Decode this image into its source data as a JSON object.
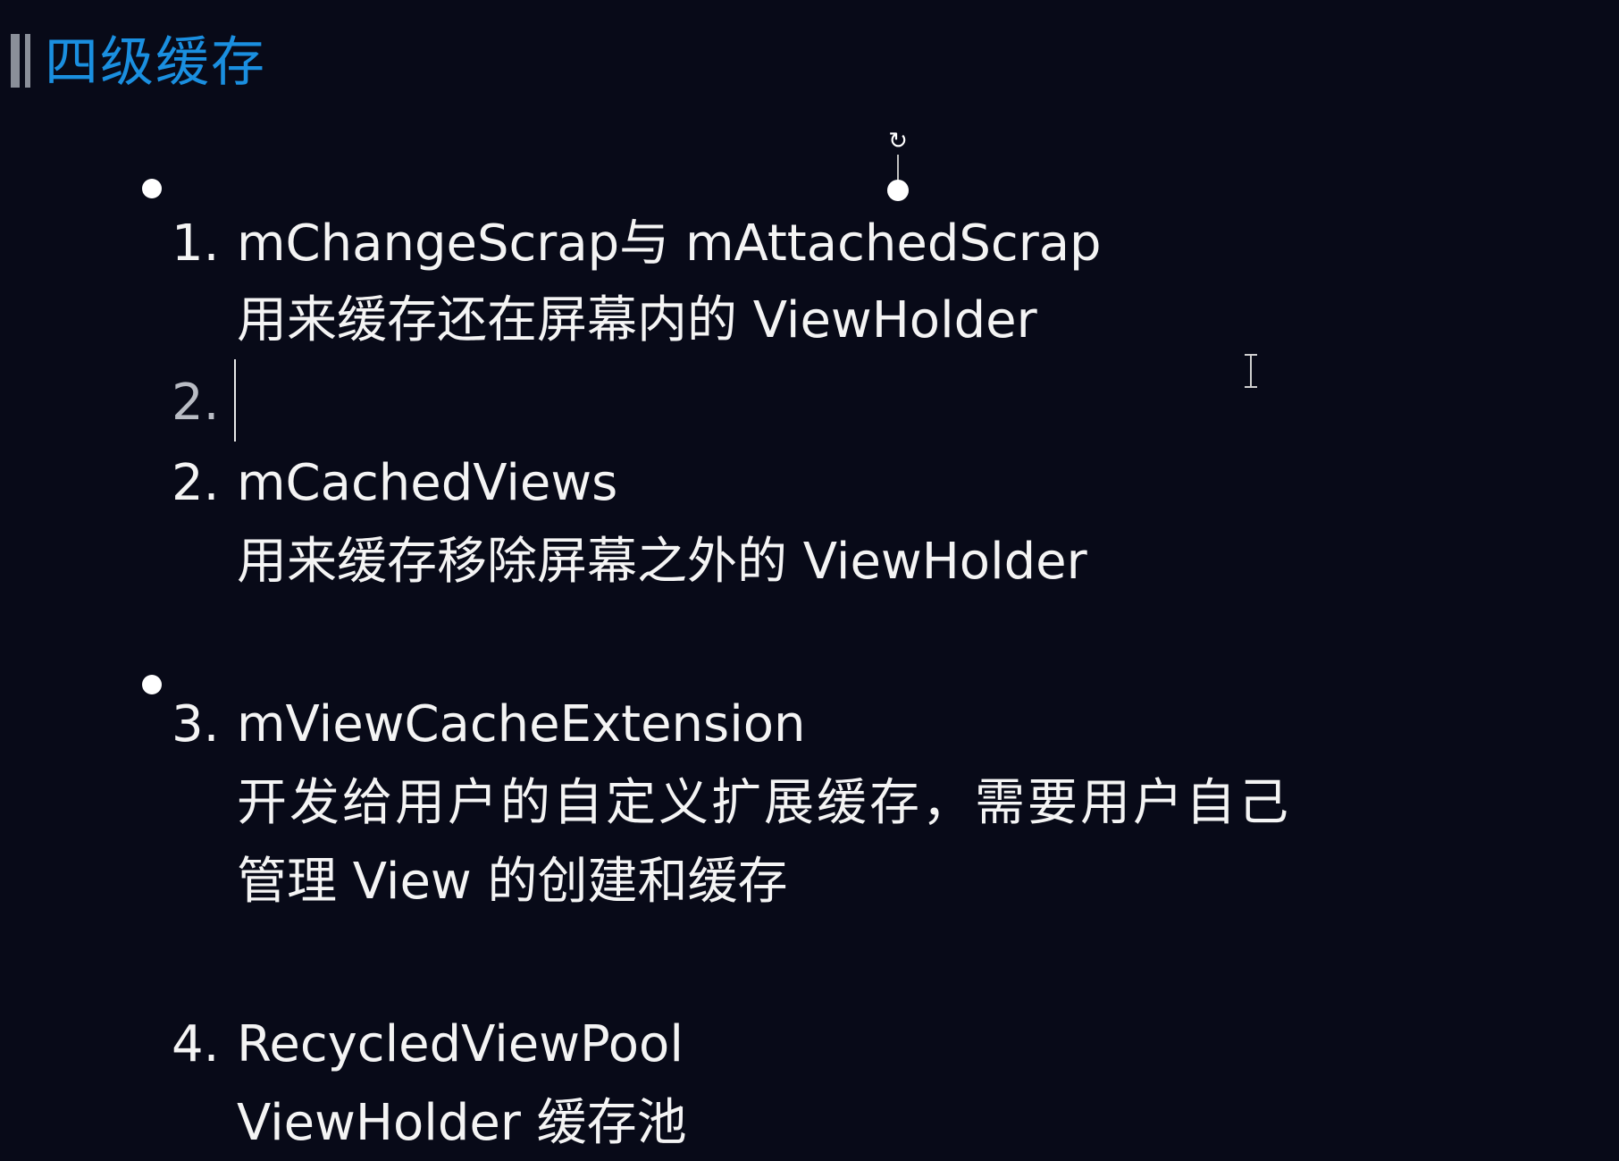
{
  "slide": {
    "title": "四级缓存",
    "items": [
      {
        "number": "1.",
        "heading": "mChangeScrap与 mAttachedScrap",
        "description": [
          "用来缓存还在屏幕内的 ViewHolder"
        ]
      },
      {
        "number": "2.",
        "heading": "",
        "description": []
      },
      {
        "number": "2.",
        "heading": "mCachedViews",
        "description": [
          "用来缓存移除屏幕之外的 ViewHolder"
        ]
      },
      {
        "number": "3.",
        "heading": "mViewCacheExtension",
        "description": [
          "开发给用户的自定义扩展缓存，需要用户自己",
          "管理 View 的创建和缓存"
        ]
      },
      {
        "number": "4.",
        "heading": "RecycledViewPool",
        "description": [
          "ViewHolder 缓存池"
        ]
      }
    ]
  },
  "icons": {
    "rotate_handle": "rotate-handle-icon",
    "text_cursor": "i-beam-cursor-icon"
  },
  "colors": {
    "background": "#080a18",
    "title": "#1a8fe0",
    "text": "#f4f4f4",
    "editing_number": "#b9bcc4"
  }
}
